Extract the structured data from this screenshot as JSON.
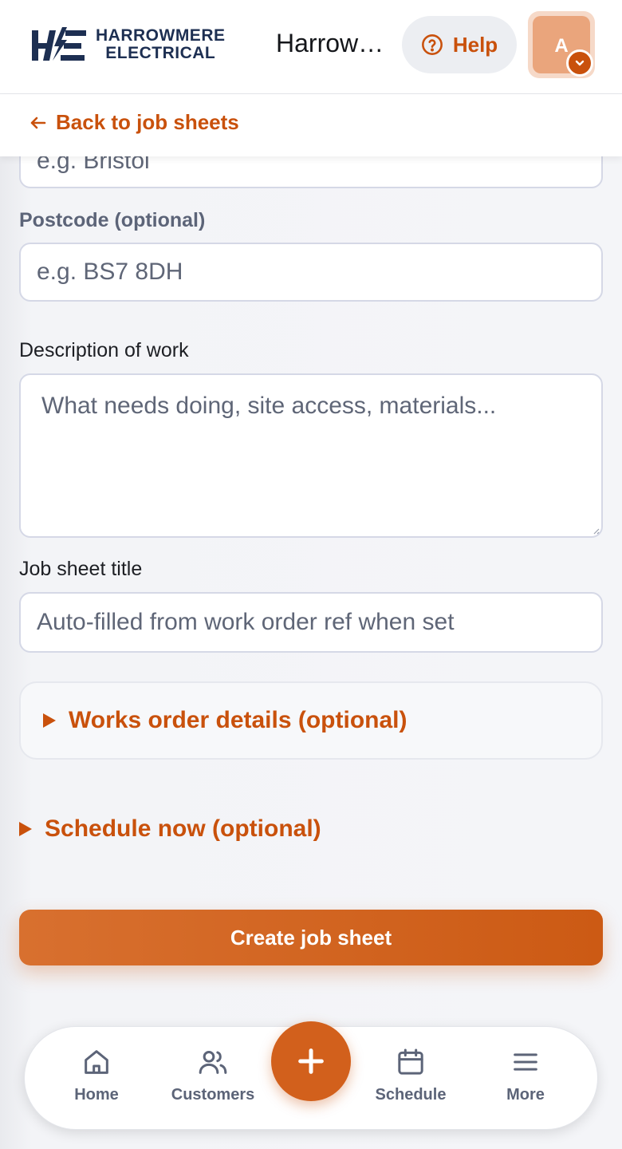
{
  "brand": {
    "logo_line1": "HARROWMERE",
    "logo_line2": "ELECTRICAL",
    "company_name": "Harrowmere Electrical",
    "accent_color": "#c9510c",
    "navy_color": "#1d2f52"
  },
  "header": {
    "help_label": "Help",
    "help_icon": "question-circle-icon",
    "avatar_initial": "A",
    "avatar_menu_icon": "chevron-down-icon"
  },
  "backbar": {
    "back_label": "Back to job sheets",
    "back_icon": "arrow-left-icon"
  },
  "form": {
    "city": {
      "placeholder": "e.g. Bristol"
    },
    "postcode": {
      "label": "Postcode (optional)",
      "placeholder": "e.g. BS7 8DH"
    },
    "description": {
      "label": "Description of work",
      "placeholder": "What needs doing, site access, materials..."
    },
    "title": {
      "label": "Job sheet title",
      "placeholder": "Auto-filled from work order ref when set"
    },
    "works_order_toggle": "Works order details (optional)",
    "schedule_toggle": "Schedule now (optional)",
    "submit_label": "Create job sheet"
  },
  "bottom_nav": {
    "items": [
      {
        "label": "Home",
        "icon": "home-icon"
      },
      {
        "label": "Customers",
        "icon": "users-icon"
      },
      {
        "label": "Schedule",
        "icon": "calendar-icon"
      },
      {
        "label": "More",
        "icon": "menu-icon"
      }
    ],
    "fab_icon": "plus-icon"
  }
}
